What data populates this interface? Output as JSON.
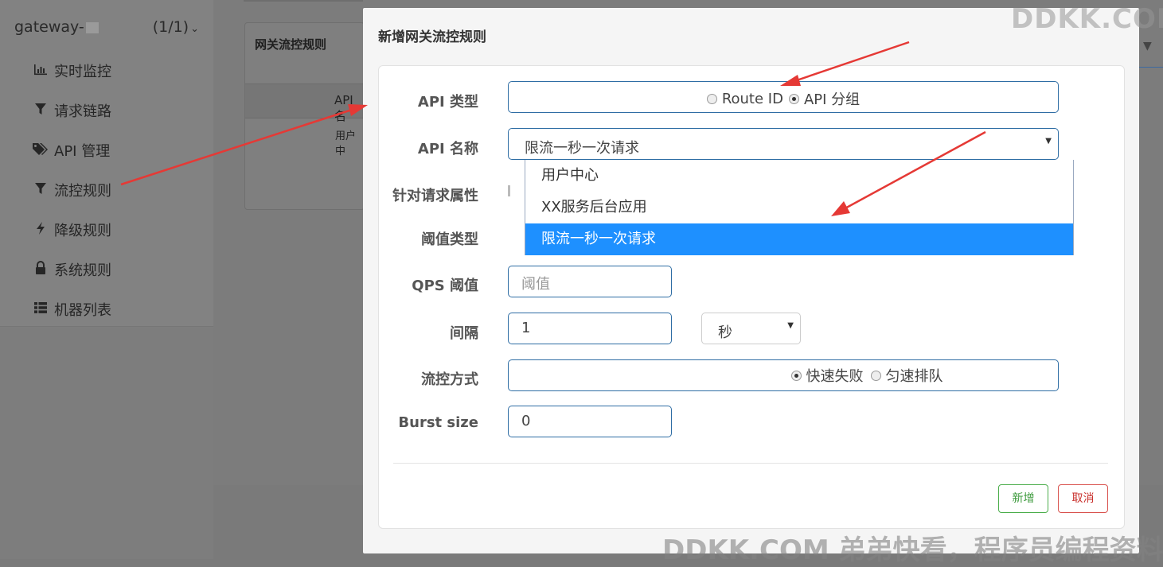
{
  "sidebar": {
    "app_name": "gateway-",
    "app_count": "(1/1)",
    "items": [
      {
        "label": "实时监控",
        "icon": "bar-chart-icon"
      },
      {
        "label": "请求链路",
        "icon": "filter-icon"
      },
      {
        "label": "API 管理",
        "icon": "tags-icon"
      },
      {
        "label": "流控规则",
        "icon": "filter-icon"
      },
      {
        "label": "降级规则",
        "icon": "lightning-icon"
      },
      {
        "label": "系统规则",
        "icon": "lock-icon"
      },
      {
        "label": "机器列表",
        "icon": "list-icon"
      }
    ]
  },
  "panel": {
    "title": "网关流控规则",
    "column_header": "API 名",
    "cell": "用户中"
  },
  "modal": {
    "title": "新增网关流控规则",
    "fields": {
      "api_type": {
        "label": "API 类型",
        "options": [
          "Route ID",
          "API 分组"
        ],
        "selected": "API 分组"
      },
      "api_name": {
        "label": "API 名称",
        "value": "限流一秒一次请求",
        "options": [
          "用户中心",
          "XX服务后台应用",
          "限流一秒一次请求"
        ],
        "highlighted": "限流一秒一次请求"
      },
      "request_attr": {
        "label": "针对请求属性"
      },
      "threshold_type": {
        "label": "阈值类型"
      },
      "qps": {
        "label": "QPS 阈值",
        "placeholder": "阈值"
      },
      "interval": {
        "label": "间隔",
        "value": "1",
        "unit": "秒"
      },
      "control_mode": {
        "label": "流控方式",
        "options": [
          "快速失败",
          "匀速排队"
        ],
        "selected": "快速失败"
      },
      "burst": {
        "label": "Burst size",
        "value": "0"
      }
    },
    "buttons": {
      "add": "新增",
      "cancel": "取消"
    }
  },
  "watermarks": {
    "top": "DDKK.COM",
    "bottom": "DDKK.COM 弟弟快看，程序员编程资料"
  },
  "colors": {
    "primary_border": "#2e6da4",
    "highlight": "#1e90ff",
    "success": "#4cae4c",
    "danger": "#d9534f",
    "arrow": "#e53935"
  }
}
